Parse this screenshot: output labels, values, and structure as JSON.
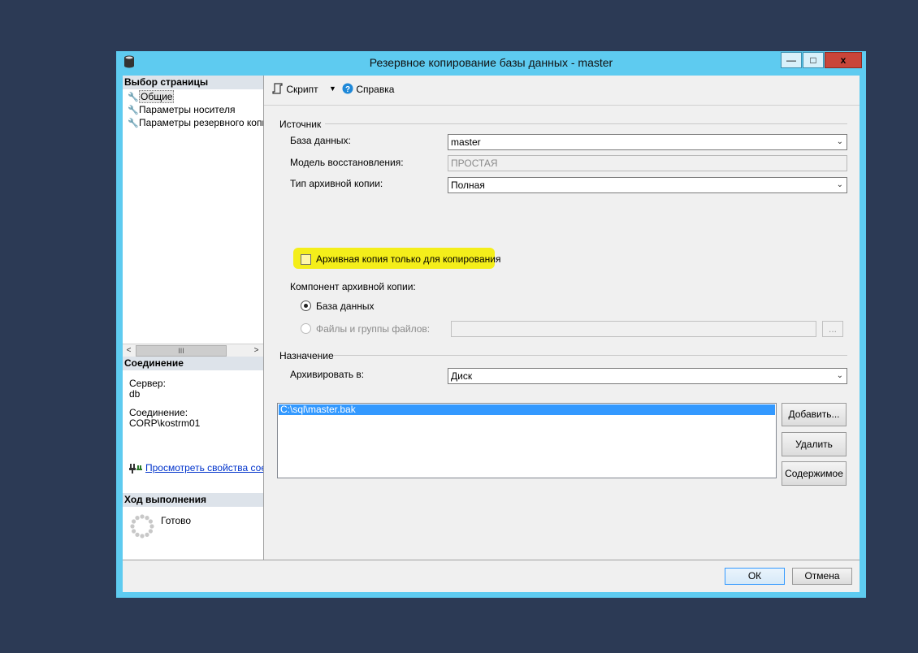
{
  "window": {
    "title": "Резервное копирование базы данных - master",
    "min_glyph": "—",
    "max_glyph": "□",
    "close_glyph": "x"
  },
  "left": {
    "select_page_header": "Выбор страницы",
    "pages": [
      {
        "label": "Общие",
        "selected": true
      },
      {
        "label": "Параметры носителя",
        "selected": false
      },
      {
        "label": "Параметры резервного копир",
        "selected": false
      }
    ],
    "scroll_thumb": "III",
    "connection_header": "Соединение",
    "server_label": "Сервер:",
    "server_value": "db",
    "connection_label": "Соединение:",
    "connection_value": "CORP\\kostrm01",
    "view_props_link": "Просмотреть свойства соед",
    "progress_header": "Ход выполнения",
    "progress_status": "Готово"
  },
  "toolbar": {
    "script_label": "Скрипт",
    "help_label": "Справка"
  },
  "source": {
    "group_label": "Источник",
    "database_label": "База данных:",
    "database_value": "master",
    "recovery_label": "Модель восстановления:",
    "recovery_value": "ПРОСТАЯ",
    "backup_type_label": "Тип архивной копии:",
    "backup_type_value": "Полная",
    "copy_only_label": "Архивная копия только для копирования",
    "component_label": "Компонент архивной копии:",
    "component_database": "База данных",
    "component_files": "Файлы и группы файлов:",
    "browse_label": "..."
  },
  "destination": {
    "group_label": "Назначение",
    "backup_to_label": "Архивировать в:",
    "backup_to_value": "Диск",
    "files": [
      "C:\\sql\\master.bak"
    ],
    "add_button": "Добавить...",
    "remove_button": "Удалить",
    "contents_button": "Содержимое"
  },
  "footer": {
    "ok_button": "ОК",
    "cancel_button": "Отмена"
  }
}
